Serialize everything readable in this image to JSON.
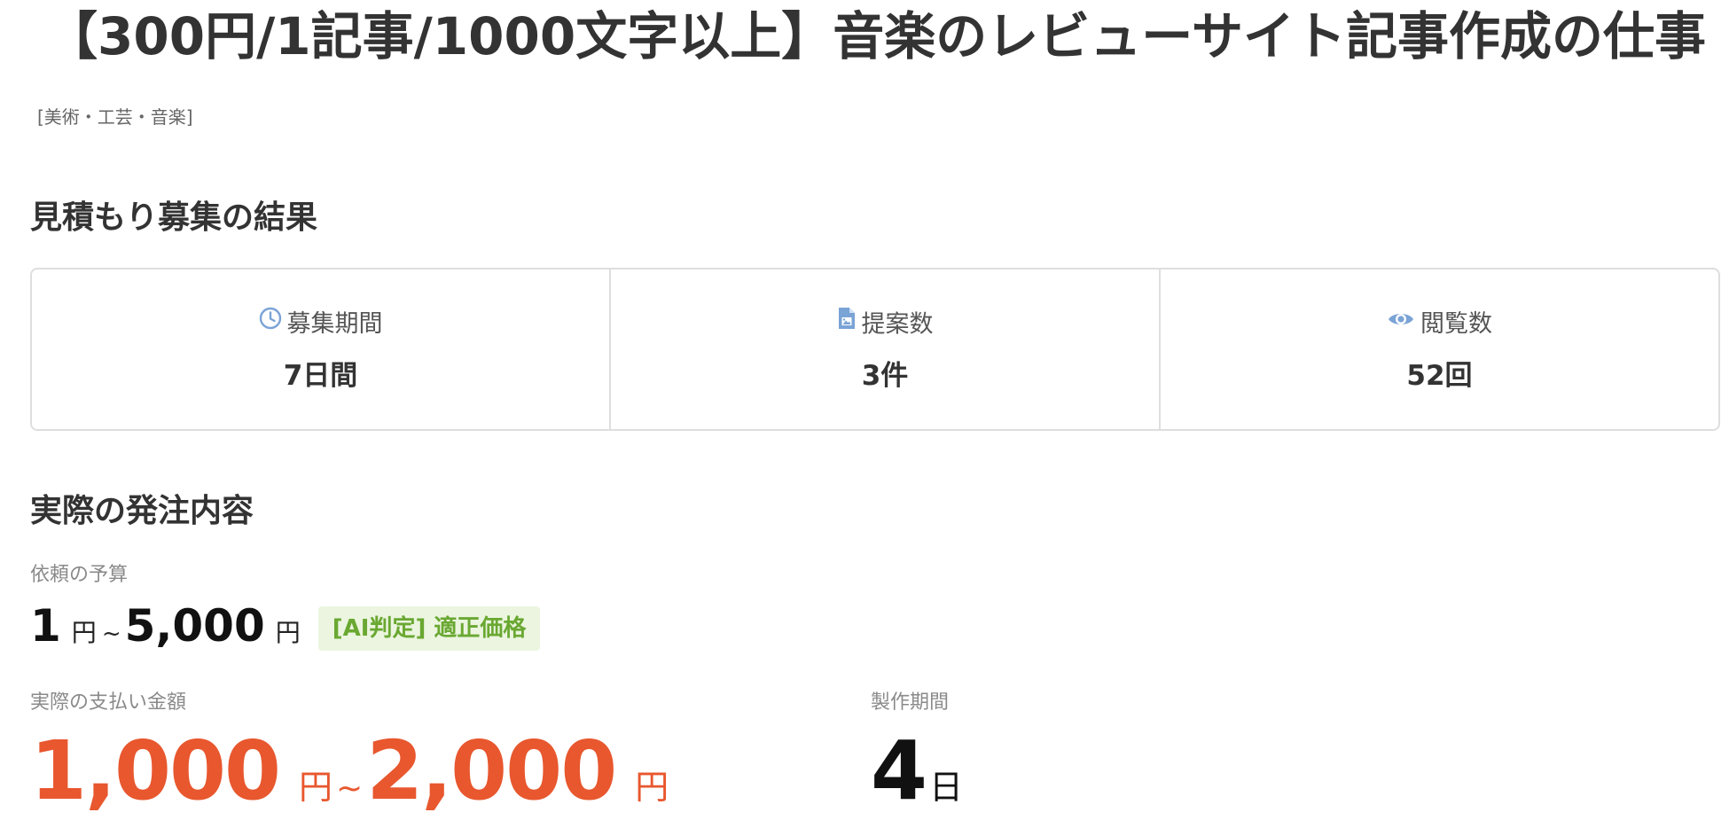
{
  "page": {
    "title": "【300円/1記事/1000文字以上】音楽のレビューサイト記事作成の仕事",
    "category": "[美術・工芸・音楽]"
  },
  "results_section": {
    "heading": "見積もり募集の結果",
    "stats": [
      {
        "icon": "clock-icon",
        "label": "募集期間",
        "value": "7日間"
      },
      {
        "icon": "document-icon",
        "label": "提案数",
        "value": "3件"
      },
      {
        "icon": "eye-icon",
        "label": "閲覧数",
        "value": "52回"
      }
    ]
  },
  "order_section": {
    "heading": "実際の発注内容",
    "budget": {
      "label": "依頼の予算",
      "min": "1",
      "max": "5,000",
      "unit": "円",
      "separator": "~",
      "ai_badge": "[AI判定] 適正価格"
    },
    "payment": {
      "label": "実際の支払い金額",
      "min": "1,000",
      "max": "2,000",
      "unit": "円",
      "separator": "~"
    },
    "period": {
      "label": "製作期間",
      "value": "4",
      "unit": "日"
    }
  },
  "colors": {
    "accent_orange": "#e8572e",
    "badge_green": "#6aa832",
    "badge_bg": "#ebf5df",
    "icon_blue": "#7aa3d6"
  }
}
